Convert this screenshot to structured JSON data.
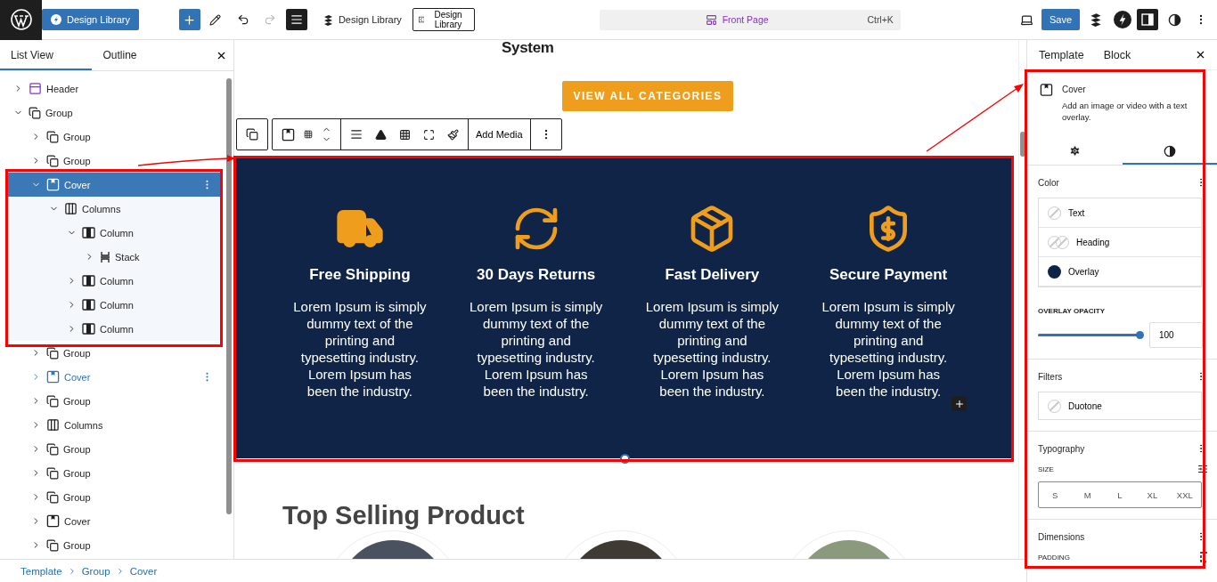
{
  "topbar": {
    "site_button": "Design Library",
    "plugin_label": "Design Library",
    "template_button": "Design Library",
    "list_view_pressed": true,
    "command": {
      "label": "Front Page",
      "shortcut": "Ctrl+K"
    },
    "save": "Save",
    "sidebar_pressed": true
  },
  "list_panel": {
    "tabs": [
      {
        "label": "List View",
        "selected": true
      },
      {
        "label": "Outline",
        "selected": false
      }
    ],
    "tree": [
      {
        "label": "Header",
        "kind": "header",
        "expanded": false,
        "selected": false,
        "hovered": false
      },
      {
        "label": "Group",
        "kind": "group",
        "expanded": true,
        "selected": false,
        "hovered": false,
        "children": [
          {
            "label": "Group",
            "kind": "group",
            "expanded": false,
            "selected": false,
            "hovered": false
          },
          {
            "label": "Group",
            "kind": "group",
            "expanded": false,
            "selected": false,
            "hovered": false
          },
          {
            "label": "Cover",
            "kind": "cover",
            "expanded": true,
            "selected": true,
            "hovered": false,
            "children": [
              {
                "label": "Columns",
                "kind": "columns",
                "expanded": true,
                "selected": false,
                "hovered": false,
                "children": [
                  {
                    "label": "Column",
                    "kind": "column",
                    "expanded": true,
                    "selected": false,
                    "hovered": false,
                    "children": [
                      {
                        "label": "Stack",
                        "kind": "stack",
                        "expanded": false,
                        "selected": false,
                        "hovered": false
                      }
                    ]
                  },
                  {
                    "label": "Column",
                    "kind": "column",
                    "expanded": false,
                    "selected": false,
                    "hovered": false
                  },
                  {
                    "label": "Column",
                    "kind": "column",
                    "expanded": false,
                    "selected": false,
                    "hovered": false
                  },
                  {
                    "label": "Column",
                    "kind": "column",
                    "expanded": false,
                    "selected": false,
                    "hovered": false
                  }
                ]
              }
            ]
          },
          {
            "label": "Group",
            "kind": "group",
            "expanded": false,
            "selected": false,
            "hovered": false
          },
          {
            "label": "Cover",
            "kind": "cover",
            "expanded": false,
            "selected": false,
            "hovered": true
          },
          {
            "label": "Group",
            "kind": "group",
            "expanded": false,
            "selected": false,
            "hovered": false
          },
          {
            "label": "Columns",
            "kind": "columns",
            "expanded": false,
            "selected": false,
            "hovered": false
          },
          {
            "label": "Group",
            "kind": "group",
            "expanded": false,
            "selected": false,
            "hovered": false
          },
          {
            "label": "Group",
            "kind": "group",
            "expanded": false,
            "selected": false,
            "hovered": false
          },
          {
            "label": "Group",
            "kind": "group",
            "expanded": false,
            "selected": false,
            "hovered": false
          },
          {
            "label": "Cover",
            "kind": "cover",
            "expanded": false,
            "selected": false,
            "hovered": false
          },
          {
            "label": "Group",
            "kind": "group",
            "expanded": false,
            "selected": false,
            "hovered": false
          }
        ]
      }
    ]
  },
  "breadcrumb": [
    "Template",
    "Group",
    "Cover"
  ],
  "canvas": {
    "heading": "System",
    "button": "VIEW ALL CATEGORIES",
    "toolbar_action": "Add Media",
    "features": [
      {
        "title": "Free Shipping",
        "text": "Lorem Ipsum is simply dummy text of the printing and typesetting industry. Lorem Ipsum has been the industry."
      },
      {
        "title": "30 Days Returns",
        "text": "Lorem Ipsum is simply dummy text of the printing and typesetting industry. Lorem Ipsum has been the industry."
      },
      {
        "title": "Fast Delivery",
        "text": "Lorem Ipsum is simply dummy text of the printing and typesetting industry. Lorem Ipsum has been the industry."
      },
      {
        "title": "Secure Payment",
        "text": "Lorem Ipsum is simply dummy text of the printing and typesetting industry. Lorem Ipsum has been the industry."
      }
    ],
    "section_title": "Top Selling Product"
  },
  "inspector": {
    "tabs": [
      "Template",
      "Block"
    ],
    "block": {
      "name": "Cover",
      "description": "Add an image or video with a text overlay."
    },
    "subtabs": [
      {
        "kind": "settings",
        "selected": false
      },
      {
        "kind": "styles",
        "selected": true
      }
    ],
    "color": {
      "title": "Color",
      "items": [
        {
          "label": "Text",
          "kind": "empty"
        },
        {
          "label": "Heading",
          "kind": "pair"
        },
        {
          "label": "Overlay",
          "kind": "swatch",
          "color": "#0f2446"
        }
      ]
    },
    "overlay_opacity": {
      "label": "OVERLAY OPACITY",
      "level": 1,
      "value": "100"
    },
    "filters": {
      "title": "Filters",
      "items": [
        "Duotone"
      ]
    },
    "typography": {
      "title": "Typography",
      "size_label": "SIZE",
      "sizes": [
        "S",
        "M",
        "L",
        "XL",
        "XXL"
      ]
    },
    "dimensions": {
      "title": "Dimensions",
      "padding_label": "PADDING"
    }
  }
}
